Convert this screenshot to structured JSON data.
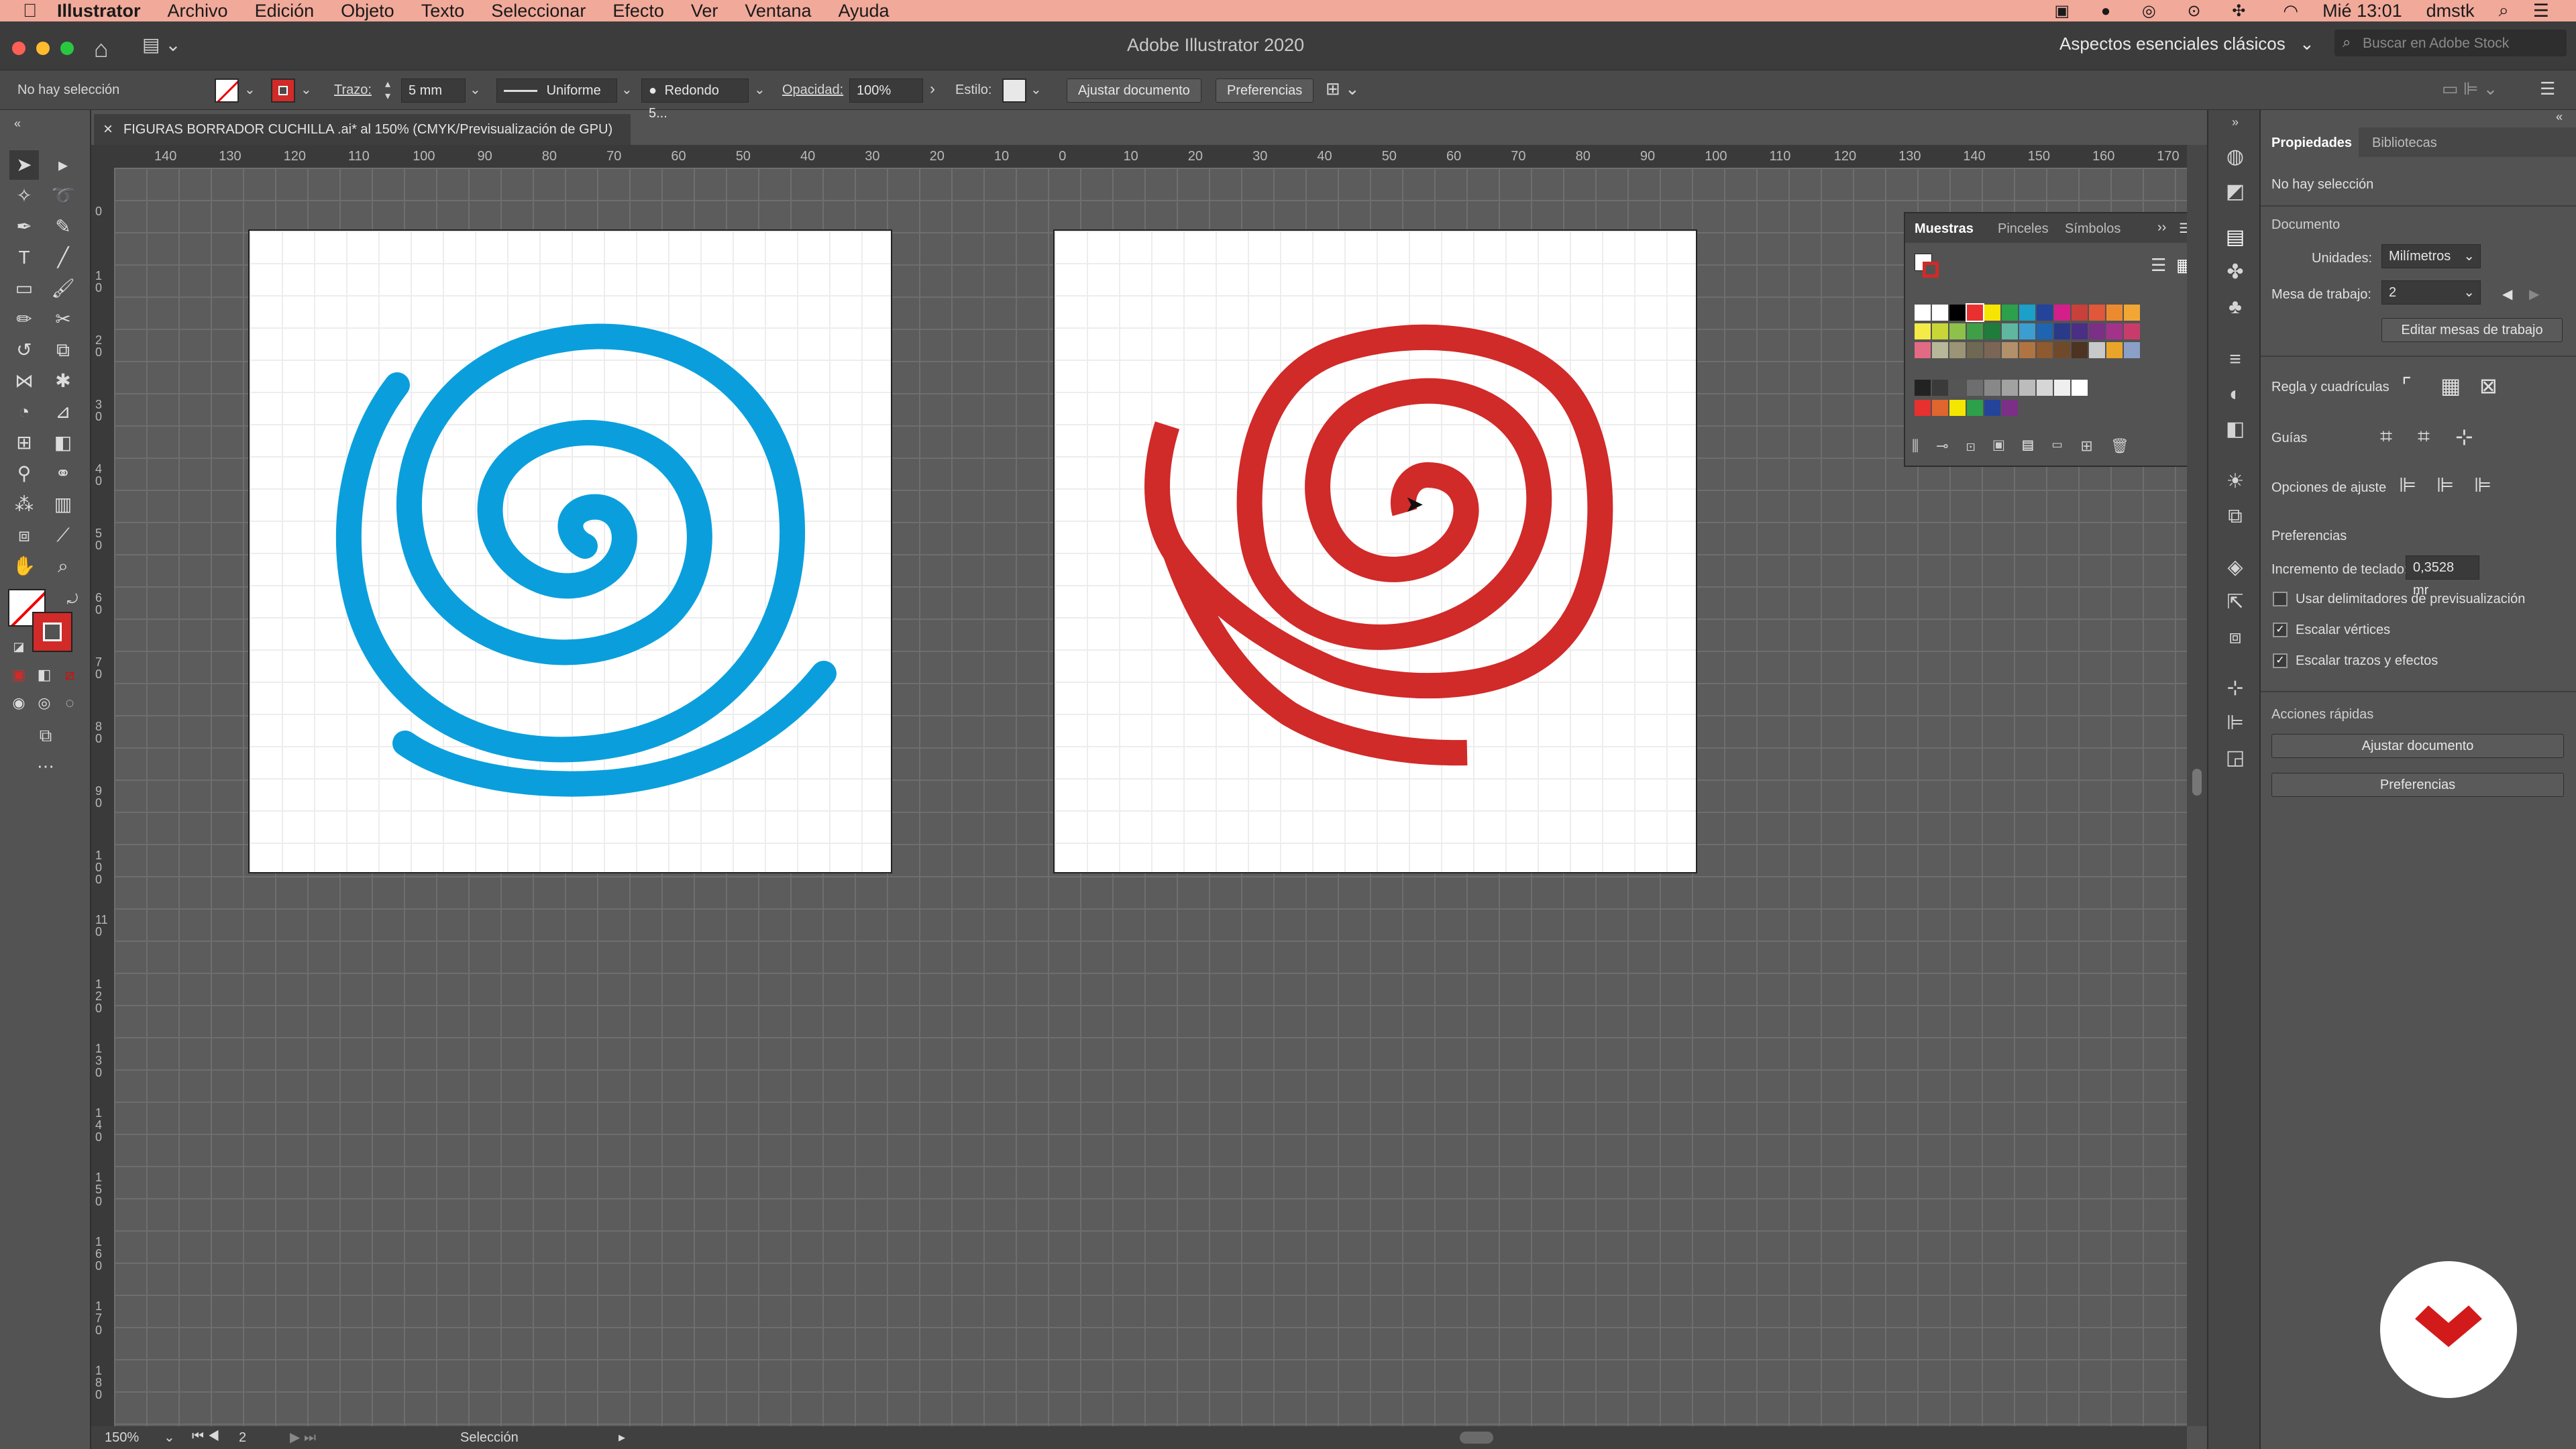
{
  "menubar": {
    "app": "Illustrator",
    "items": [
      "Archivo",
      "Edición",
      "Objeto",
      "Texto",
      "Seleccionar",
      "Efecto",
      "Ver",
      "Ventana",
      "Ayuda"
    ],
    "clock": "Mié 13:01",
    "user": "dmstk"
  },
  "titlebar": {
    "title": "Adobe Illustrator 2020",
    "workspace": "Aspectos esenciales clásicos",
    "search_placeholder": "Buscar en Adobe Stock"
  },
  "control": {
    "selection": "No hay selección",
    "stroke_label": "Trazo:",
    "stroke_value": "5 mm",
    "profile": "Uniforme",
    "brush": "Redondo 5...",
    "opacity_label": "Opacidad:",
    "opacity_value": "100%",
    "style_label": "Estilo:",
    "fit_doc": "Ajustar documento",
    "prefs": "Preferencias"
  },
  "document": {
    "tab_title": "FIGURAS BORRADOR CUCHILLA .ai* al 150% (CMYK/Previsualización de GPU)",
    "close": "×"
  },
  "rulers": {
    "h": [
      "140",
      "130",
      "120",
      "110",
      "100",
      "90",
      "80",
      "70",
      "60",
      "50",
      "40",
      "30",
      "20",
      "10",
      "0",
      "10",
      "20",
      "30",
      "40",
      "50",
      "60",
      "70",
      "80",
      "90",
      "100",
      "110",
      "120",
      "130",
      "140",
      "150",
      "160",
      "170"
    ],
    "v": [
      "0",
      "1 0",
      "2 0",
      "3 0",
      "4 0",
      "5 0",
      "6 0",
      "7 0",
      "8 0",
      "9 0",
      "1 0 0",
      "1 1 0",
      "1 2 0",
      "1 3 0",
      "1 4 0",
      "1 5 0",
      "1 6 0",
      "1 7 0",
      "1 8 0"
    ]
  },
  "status": {
    "zoom": "150%",
    "artboard": "2",
    "tool": "Selección"
  },
  "swatches": {
    "tabs": [
      "Muestras",
      "Pinceles",
      "Símbolos"
    ],
    "row1": [
      "#ffffff",
      "#ffffff",
      "#000000",
      "#e8302f",
      "#f4e600",
      "#2ca04a",
      "#1aa0c9",
      "#24439a",
      "#d41f8a",
      "#c7403a",
      "#e0573a",
      "#ec8a2f",
      "#f2a735"
    ],
    "row2": [
      "#f5eb46",
      "#c8d638",
      "#8dc14a",
      "#3f9f47",
      "#1f7c3b",
      "#5fb7a0",
      "#3c9dd0",
      "#1e64b0",
      "#2a3a89",
      "#4a2f84",
      "#7c2f87",
      "#a3338a",
      "#c83c6b"
    ],
    "row3": [
      "#e36a84",
      "#b7b89a",
      "#9b9475",
      "#6f6852",
      "#7a6556",
      "#b2906a",
      "#b07443",
      "#8e5a2f",
      "#6f4a2a",
      "#4d3322",
      "#c9c9c9",
      "#e9a52a",
      "#8aa0c6"
    ],
    "row4": [
      "#222222",
      "#3a3a3a",
      "#555555",
      "#6e6e6e",
      "#888888",
      "#a2a2a2",
      "#bcbcbc",
      "#d6d6d6",
      "#efefef",
      "#ffffff"
    ],
    "row5": [
      "#e8302f",
      "#e1652e",
      "#f4e600",
      "#2ca04a",
      "#24439a",
      "#7c2f87"
    ]
  },
  "properties": {
    "tabs": [
      "Propiedades",
      "Bibliotecas"
    ],
    "no_selection": "No hay selección",
    "document_title": "Documento",
    "units_label": "Unidades:",
    "units_value": "Milímetros",
    "artboard_label": "Mesa de trabajo:",
    "artboard_value": "2",
    "edit_artboards": "Editar mesas de trabajo",
    "rulers_grids": "Regla y cuadrículas",
    "guides": "Guías",
    "snap_options": "Opciones de ajuste",
    "preferences": "Preferencias",
    "keyboard_inc_label": "Incremento de teclado:",
    "keyboard_inc_value": "0,3528 mr",
    "check_preview_bounds": "Usar delimitadores de previsualización",
    "check_scale_corners": "Escalar vértices",
    "check_scale_strokes": "Escalar trazos y efectos",
    "quick_actions": "Acciones rápidas",
    "fit_doc": "Ajustar documento",
    "prefs": "Preferencias"
  },
  "colors": {
    "blue_spiral": "#0a9fdc",
    "red_spiral": "#d02a29",
    "brand_red": "#d31a1a"
  }
}
